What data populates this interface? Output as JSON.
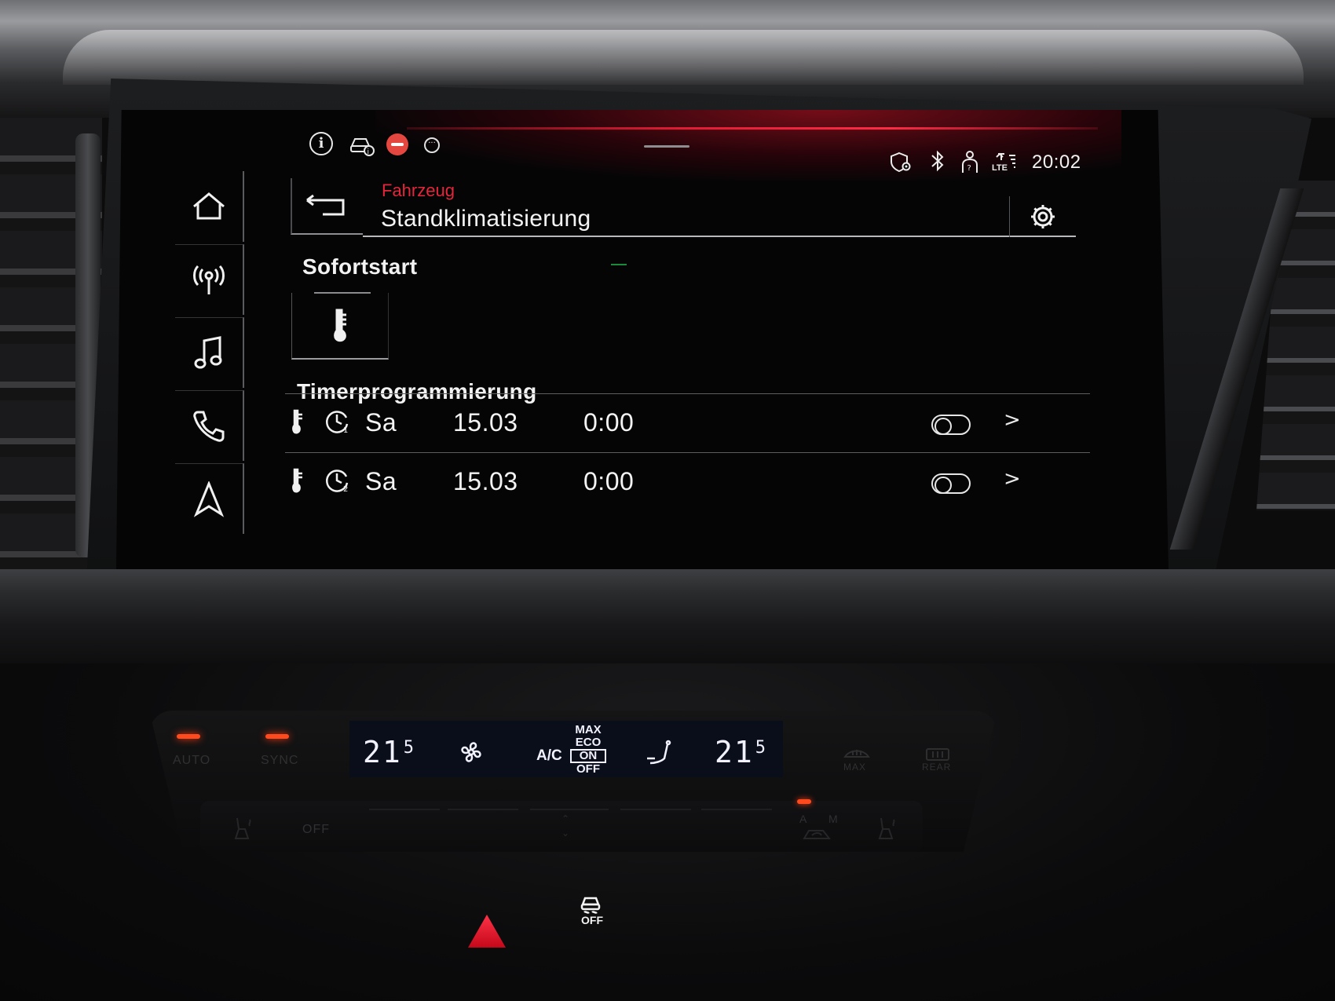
{
  "status_bar": {
    "info_label": "i",
    "clock": "20:02",
    "lte_label": "LTE"
  },
  "navigation": {
    "items": [
      {
        "name": "home",
        "icon": "home-icon"
      },
      {
        "name": "radio",
        "icon": "antenna-icon"
      },
      {
        "name": "media",
        "icon": "music-note-icon"
      },
      {
        "name": "phone",
        "icon": "phone-icon"
      },
      {
        "name": "navigation",
        "icon": "navigation-arrow-icon"
      }
    ]
  },
  "header": {
    "breadcrumb": "Fahrzeug",
    "title": "Standklimatisierung",
    "accent_color": "#e3263c"
  },
  "immediate_start": {
    "title": "Sofortstart",
    "icon": "thermometer-icon"
  },
  "timers": {
    "title": "Timerprogrammierung",
    "rows": [
      {
        "timer_number": "1",
        "day": "Sa",
        "date": "15.03",
        "time": "0:00",
        "enabled": false
      },
      {
        "timer_number": "2",
        "day": "Sa",
        "date": "15.03",
        "time": "0:00",
        "enabled": false
      }
    ],
    "chevron": ">"
  },
  "climate_panel": {
    "left_temp_int": "21",
    "left_temp_dec": "5",
    "right_temp_int": "21",
    "right_temp_dec": "5",
    "ac_label": "A/C",
    "ac_max": "MAX",
    "ac_eco": "ECO",
    "ac_on": "ON",
    "ac_off": "OFF",
    "auto_label": "AUTO",
    "sync_label": "SYNC",
    "off_label": "OFF",
    "max_label": "MAX",
    "rear_label": "REAR",
    "recirc_a": "A",
    "recirc_m": "M",
    "esc_off_label": "OFF",
    "display_color": "#f2f2ff",
    "led_color": "#ff4a1e"
  }
}
